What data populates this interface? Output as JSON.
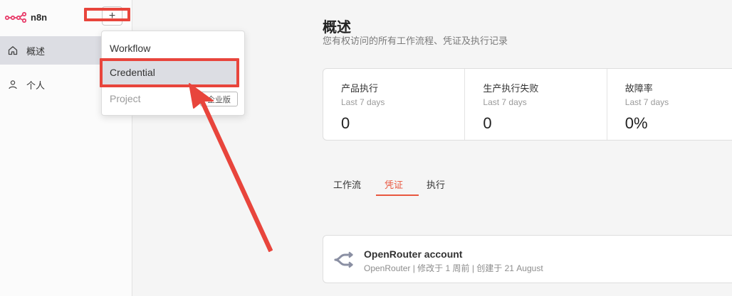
{
  "brand": {
    "name": "n8n",
    "color": "#e83e6b"
  },
  "sidebar": {
    "add_label": "+",
    "items": [
      {
        "label": "概述",
        "icon": "home-icon"
      },
      {
        "label": "个人",
        "icon": "user-icon"
      }
    ]
  },
  "dropdown": {
    "items": [
      {
        "label": "Workflow"
      },
      {
        "label": "Credential"
      },
      {
        "label": "Project",
        "badge": "企业版"
      }
    ]
  },
  "main": {
    "title": "概述",
    "subtitle": "您有权访问的所有工作流程、凭证及执行记录",
    "stats": [
      {
        "label": "产品执行",
        "sub": "Last 7 days",
        "value": "0"
      },
      {
        "label": "生产执行失败",
        "sub": "Last 7 days",
        "value": "0"
      },
      {
        "label": "故障率",
        "sub": "Last 7 days",
        "value": "0%"
      }
    ],
    "tabs": [
      {
        "label": "工作流"
      },
      {
        "label": "凭证",
        "active": true
      },
      {
        "label": "执行"
      }
    ],
    "credential": {
      "name": "OpenRouter account",
      "meta": "OpenRouter | 修改于 1 周前 | 创建于 21 August",
      "icon": "openrouter-icon"
    }
  },
  "colors": {
    "accent": "#e8573f",
    "annotation": "#e8453c"
  }
}
